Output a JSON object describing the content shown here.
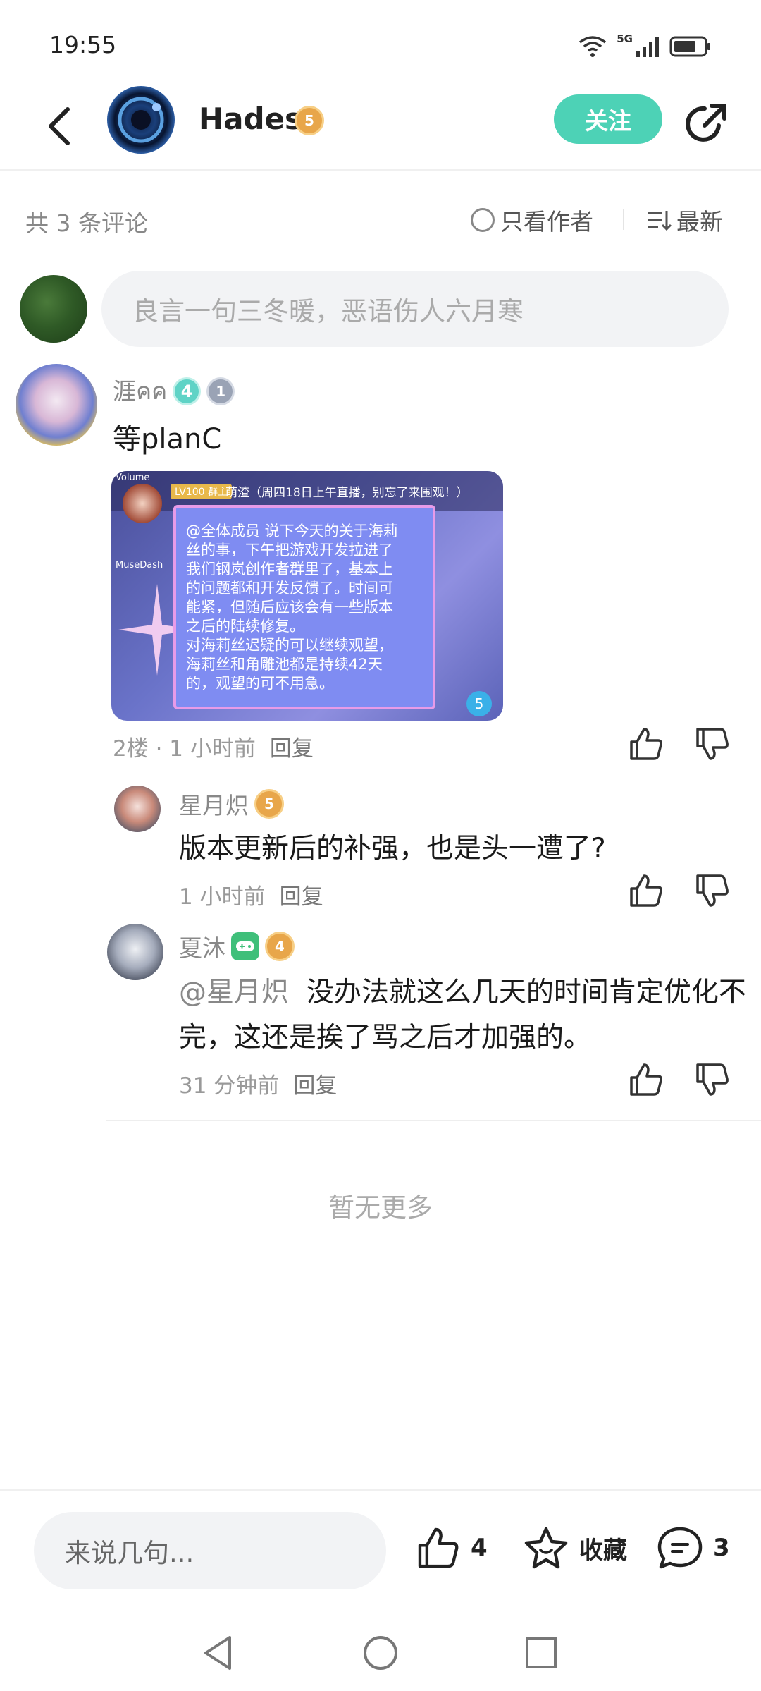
{
  "status_bar": {
    "time": "19:55",
    "network": "5G",
    "icons": [
      "wifi-icon",
      "signal-icon",
      "battery-icon"
    ]
  },
  "header": {
    "name": "Hades",
    "level": "5",
    "follow_label": "关注",
    "icons": [
      "back-icon",
      "share-icon"
    ]
  },
  "filter": {
    "count_label": "共 3 条评论",
    "author_only_label": "只看作者",
    "sort_label": "最新"
  },
  "comment_input": {
    "placeholder": "良言一句三冬暖，恶语伤人六月寒"
  },
  "main_comment": {
    "author": "涯คค",
    "badge_number": "4",
    "badge_level": "1",
    "text": "等planC",
    "image": {
      "top_label_left": "Volume",
      "lv_tag": "LV100 群主",
      "header_text": "萌渣（周四18日上午直播，别忘了来围观！）",
      "side_label": "MuseDash",
      "body": "@全体成员 说下今天的关于海莉\n丝的事，下午把游戏开发拉进了\n我们钢岚创作者群里了，基本上\n的问题都和开发反馈了。时间可\n能紧，但随后应该会有一些版本\n之后的陆续修复。\n对海莉丝迟疑的可以继续观望，\n海莉丝和角雕池都是持续42天\n的，观望的可不用急。",
      "count": "5"
    },
    "floor": "2楼 · 1 小时前",
    "reply_label": "回复"
  },
  "replies": [
    {
      "author": "星月炽",
      "badge_level": "5",
      "text": "版本更新后的补强，也是头一遭了?",
      "time": "1 小时前",
      "reply_label": "回复"
    },
    {
      "author": "夏沐",
      "badge_level": "4",
      "mention": "@星月炽",
      "text": "没办法就这么几天的时间肯定优化不完，这还是挨了骂之后才加强的。",
      "time": "31 分钟前",
      "reply_label": "回复"
    }
  ],
  "no_more_label": "暂无更多",
  "bottom_bar": {
    "input_placeholder": "来说几句...",
    "like_count": "4",
    "favorite_label": "收藏",
    "comment_count": "3"
  },
  "colors": {
    "accent": "#4dd2b6",
    "badge_gold": "#e8a64a",
    "badge_teal": "#5fd3c6",
    "muted_text": "#999999"
  }
}
